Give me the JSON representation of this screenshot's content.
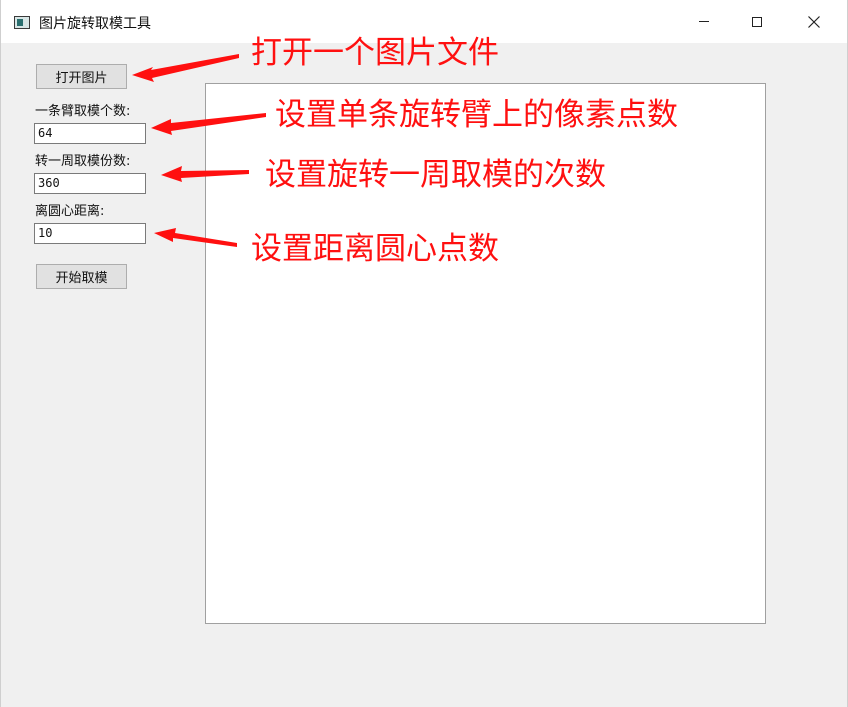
{
  "window": {
    "title": "图片旋转取模工具",
    "icon": "app-window-icon",
    "controls": {
      "minimize": "minimize-icon",
      "maximize": "maximize-icon",
      "close": "close-icon"
    }
  },
  "left_panel": {
    "open_button_label": "打开图片",
    "arm_pixels_label": "一条臂取模个数:",
    "arm_pixels_value": "64",
    "rotation_count_label": "转一周取模份数:",
    "rotation_count_value": "360",
    "center_distance_label": "离圆心距离:",
    "center_distance_value": "10",
    "start_button_label": "开始取模"
  },
  "annotations": {
    "open_file": "打开一个图片文件",
    "arm_pixels": "设置单条旋转臂上的像素点数",
    "rotation_count": "设置旋转一周取模的次数",
    "center_distance": "设置距离圆心点数"
  },
  "colors": {
    "annotation": "#ff1010",
    "background": "#f0f0f0",
    "canvas": "#ffffff"
  }
}
